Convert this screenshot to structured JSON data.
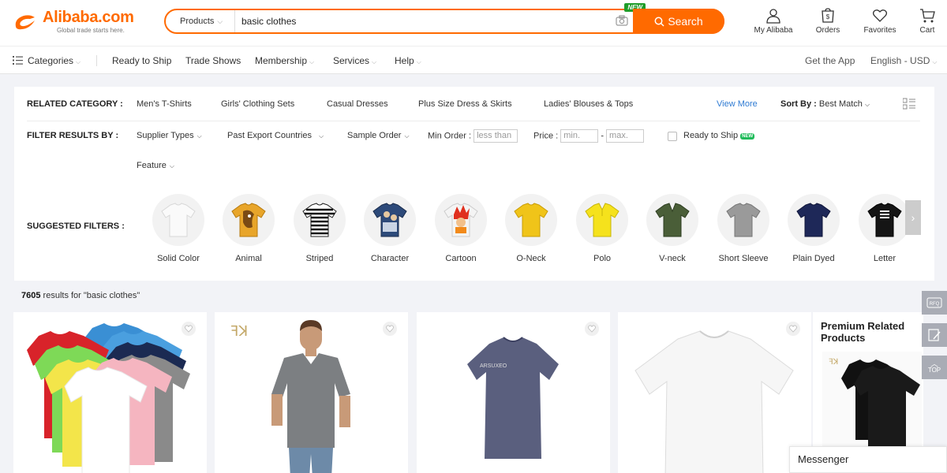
{
  "header": {
    "logo_text": "Alibaba.com",
    "logo_tagline": "Global trade starts here.",
    "search": {
      "category": "Products",
      "query": "basic clothes",
      "new_badge": "NEW",
      "button_label": "Search"
    },
    "icons": [
      {
        "label": "My Alibaba",
        "icon": "user-icon"
      },
      {
        "label": "Orders",
        "icon": "orders-icon"
      },
      {
        "label": "Favorites",
        "icon": "heart-icon"
      },
      {
        "label": "Cart",
        "icon": "cart-icon"
      }
    ]
  },
  "nav": {
    "categories": "Categories",
    "items": [
      "Ready to Ship",
      "Trade Shows",
      "Membership",
      "Services",
      "Help"
    ],
    "get_app": "Get the App",
    "language": "English - USD"
  },
  "filters": {
    "related_label": "RELATED CATEGORY :",
    "related": [
      "Men's T-Shirts",
      "Girls' Clothing Sets",
      "Casual Dresses",
      "Plus Size Dress & Skirts",
      "Ladies' Blouses & Tops"
    ],
    "view_more": "View More",
    "sort_label": "Sort By :",
    "sort_value": "Best Match",
    "filter_label": "FILTER RESULTS BY :",
    "supplier_types": "Supplier Types",
    "past_export": "Past Export Countries",
    "sample_order": "Sample Order",
    "min_order_label": "Min Order :",
    "min_order_placeholder": "less than",
    "price_label": "Price :",
    "price_min_placeholder": "min.",
    "price_max_placeholder": "max.",
    "price_dash": "-",
    "ready_to_ship": "Ready to Ship",
    "ready_new": "NEW",
    "feature": "Feature",
    "suggested_label": "SUGGESTED FILTERS :",
    "suggested": [
      "Solid Color",
      "Animal",
      "Striped",
      "Character",
      "Cartoon",
      "O-Neck",
      "Polo",
      "V-neck",
      "Short Sleeve",
      "Plain Dyed",
      "Letter"
    ]
  },
  "results": {
    "count": "7605",
    "text": "results for \"basic clothes\""
  },
  "premium": {
    "title": "Premium Related Products"
  },
  "side_tools": [
    "RFQ",
    "TOP"
  ],
  "messenger": "Messenger",
  "colors": {
    "brand": "#ff6a00",
    "link": "#2f7bd3",
    "new_badge": "#1f9d2a"
  }
}
